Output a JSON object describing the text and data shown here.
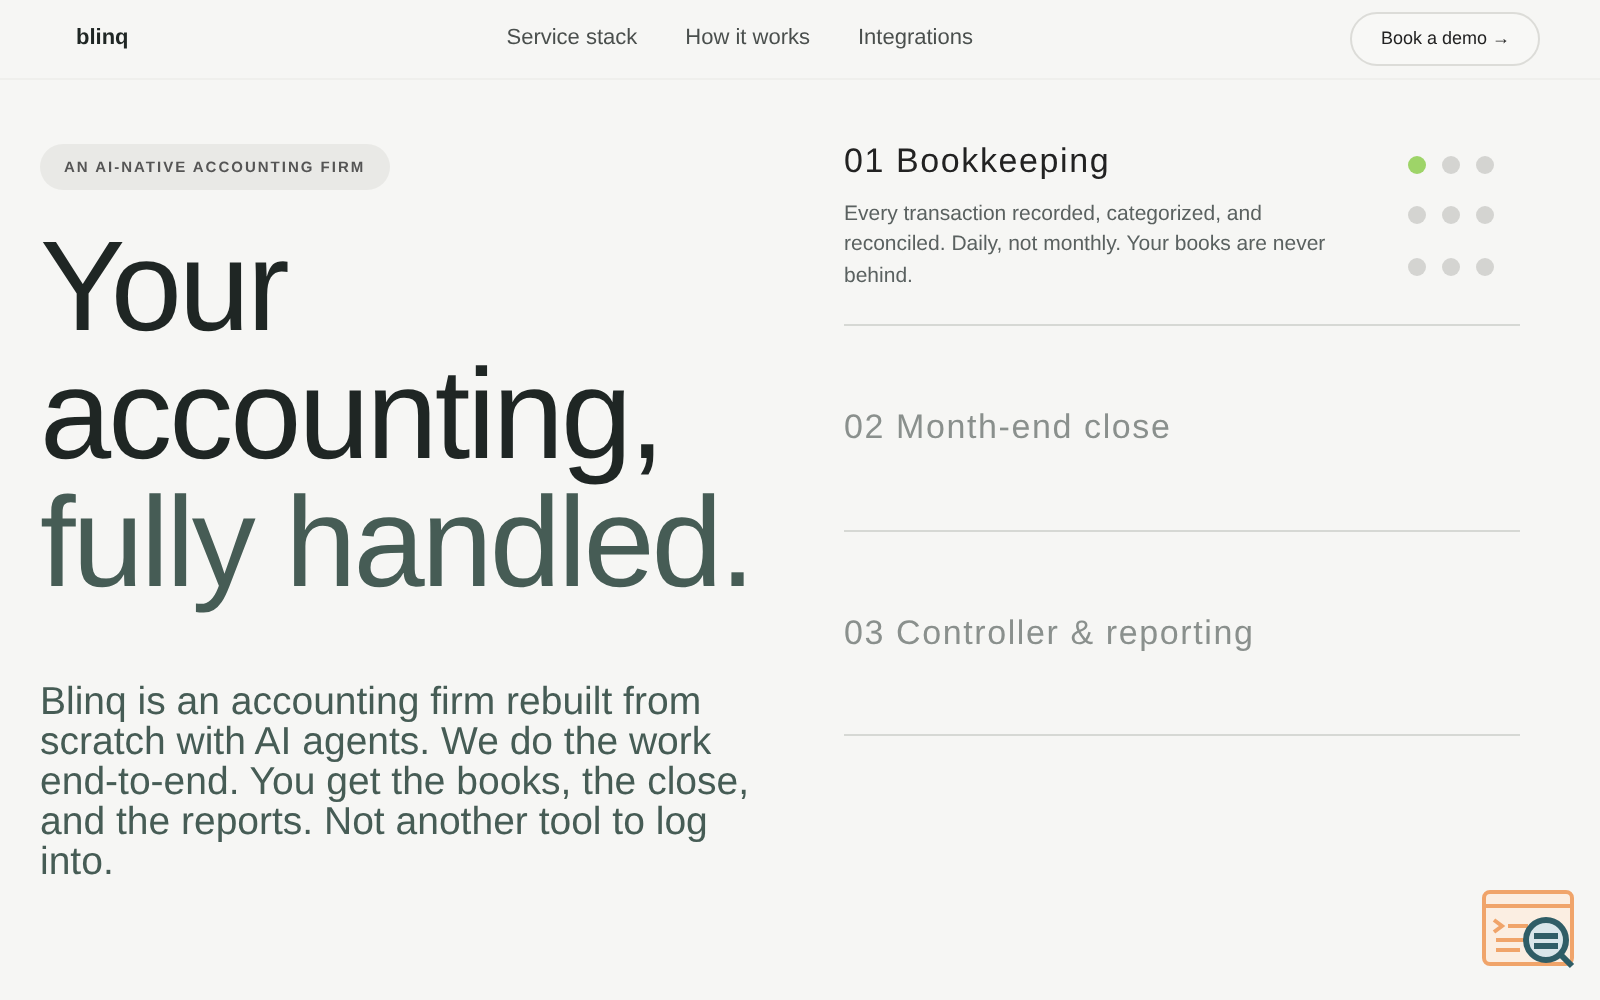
{
  "nav": {
    "logo": "blinq",
    "links": [
      "Service stack",
      "How it works",
      "Integrations"
    ],
    "cta": "Book a demo",
    "cta_arrow": "→"
  },
  "hero": {
    "eyebrow": "AN AI-NATIVE ACCOUNTING FIRM",
    "headline": "Your accounting,",
    "headline_accent": "fully handled.",
    "intro": "Blinq is an accounting firm rebuilt from scratch with AI agents. We do the work end-to-end. You get the books, the close, and the reports. Not another tool to log into."
  },
  "services": [
    {
      "title": "01 Bookkeeping",
      "selected": true,
      "description": "Every transaction recorded, categorized, and reconciled. Daily, not monthly. Your books are never behind."
    },
    {
      "title": "02 Month-end close",
      "selected": false
    },
    {
      "title": "03 Controller & reporting",
      "selected": false
    }
  ],
  "progress_dots": [
    {
      "on": true
    },
    {
      "on": false
    },
    {
      "on": false
    },
    {
      "on": false
    },
    {
      "on": false
    },
    {
      "on": false
    },
    {
      "on": false
    },
    {
      "on": false
    },
    {
      "on": false
    }
  ]
}
